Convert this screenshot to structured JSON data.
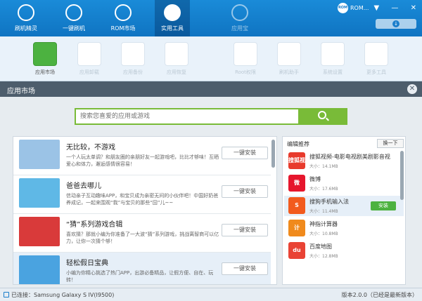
{
  "topbar": {
    "nav": [
      {
        "label": "刷机精灵"
      },
      {
        "label": "一键刷机"
      },
      {
        "label": "ROM市场"
      },
      {
        "label": "实用工具"
      },
      {
        "label": "应用宝"
      }
    ],
    "rom_badge": "ROM",
    "rom_text": "ROM...",
    "window_controls": {
      "menu": "▼",
      "minimize": "—",
      "close": "✕"
    }
  },
  "tools": [
    {
      "label": "应用市场",
      "active": true
    },
    {
      "label": "应用卸载",
      "active": false
    },
    {
      "label": "应用备份",
      "active": false
    },
    {
      "label": "应用恢复",
      "active": false
    },
    {
      "label": "Root权限",
      "active": false
    },
    {
      "label": "刷机助手",
      "active": false
    },
    {
      "label": "系统设置",
      "active": false
    },
    {
      "label": "更多工具",
      "active": false
    }
  ],
  "panel": {
    "title": "应用市场",
    "close": "✕",
    "search": {
      "placeholder": "搜索您喜爱的应用或游戏"
    }
  },
  "apps": [
    {
      "title": "无比较，不游戏",
      "desc": "一个人玩太单调？和朋友圈的亲朋好友一起游戏吧，比比才够味！互晒爱心和体力，邂逅感情很容易！",
      "button": "一键安装",
      "highlight": false,
      "color": "#9bc3e6"
    },
    {
      "title": "爸爸去哪儿",
      "desc": "信动亲子互动趣味APP，和宝贝成为亲密无间的小伙伴吧！中国好奶爸养成记，一起来围观“我”与宝贝的那些“囧”儿~~",
      "button": "一键安装",
      "highlight": false,
      "color": "#5fb8e6"
    },
    {
      "title": "“猜”系列游戏合辑",
      "desc": "喜欢猜？那就小编为你准备了一大波“猜”系列游戏，挑战离智商可以亿力，让你一次猜个够！",
      "button": "一键安装",
      "highlight": false,
      "color": "#d93a3a"
    },
    {
      "title": "轻松假日宝典",
      "desc": "小编为你精心挑选了热门APP，出游必备精品，让假方便、自在、玩转！",
      "button": "一键安装",
      "highlight": true,
      "color": "#4aa3e0"
    }
  ],
  "recommend": {
    "title": "编辑推荐",
    "refresh": "换一下",
    "items": [
      {
        "name": "搜狐视频-电影电视剧美剧影音视",
        "size": "大小：14.1MB",
        "icon_text": "搜狐视频",
        "color": "#e83a2c",
        "highlight": false,
        "install": ""
      },
      {
        "name": "微博",
        "size": "大小：17.6MB",
        "icon_text": "微",
        "color": "#e6162d",
        "highlight": false,
        "install": ""
      },
      {
        "name": "搜狗手机输入法",
        "size": "大小：11.4MB",
        "icon_text": "S",
        "color": "#f25a1d",
        "highlight": true,
        "install": "安装"
      },
      {
        "name": "神指计算器",
        "size": "大小：10.8MB",
        "icon_text": "计",
        "color": "#f08a1c",
        "highlight": false,
        "install": ""
      },
      {
        "name": "百度地图",
        "size": "大小：12.8MB",
        "icon_text": "du",
        "color": "#e94335",
        "highlight": false,
        "install": ""
      }
    ]
  },
  "status": {
    "left": "已连接：Samsung Galaxy S IV(I9500)",
    "right": "版本2.0.0（已经是最新版本）"
  }
}
